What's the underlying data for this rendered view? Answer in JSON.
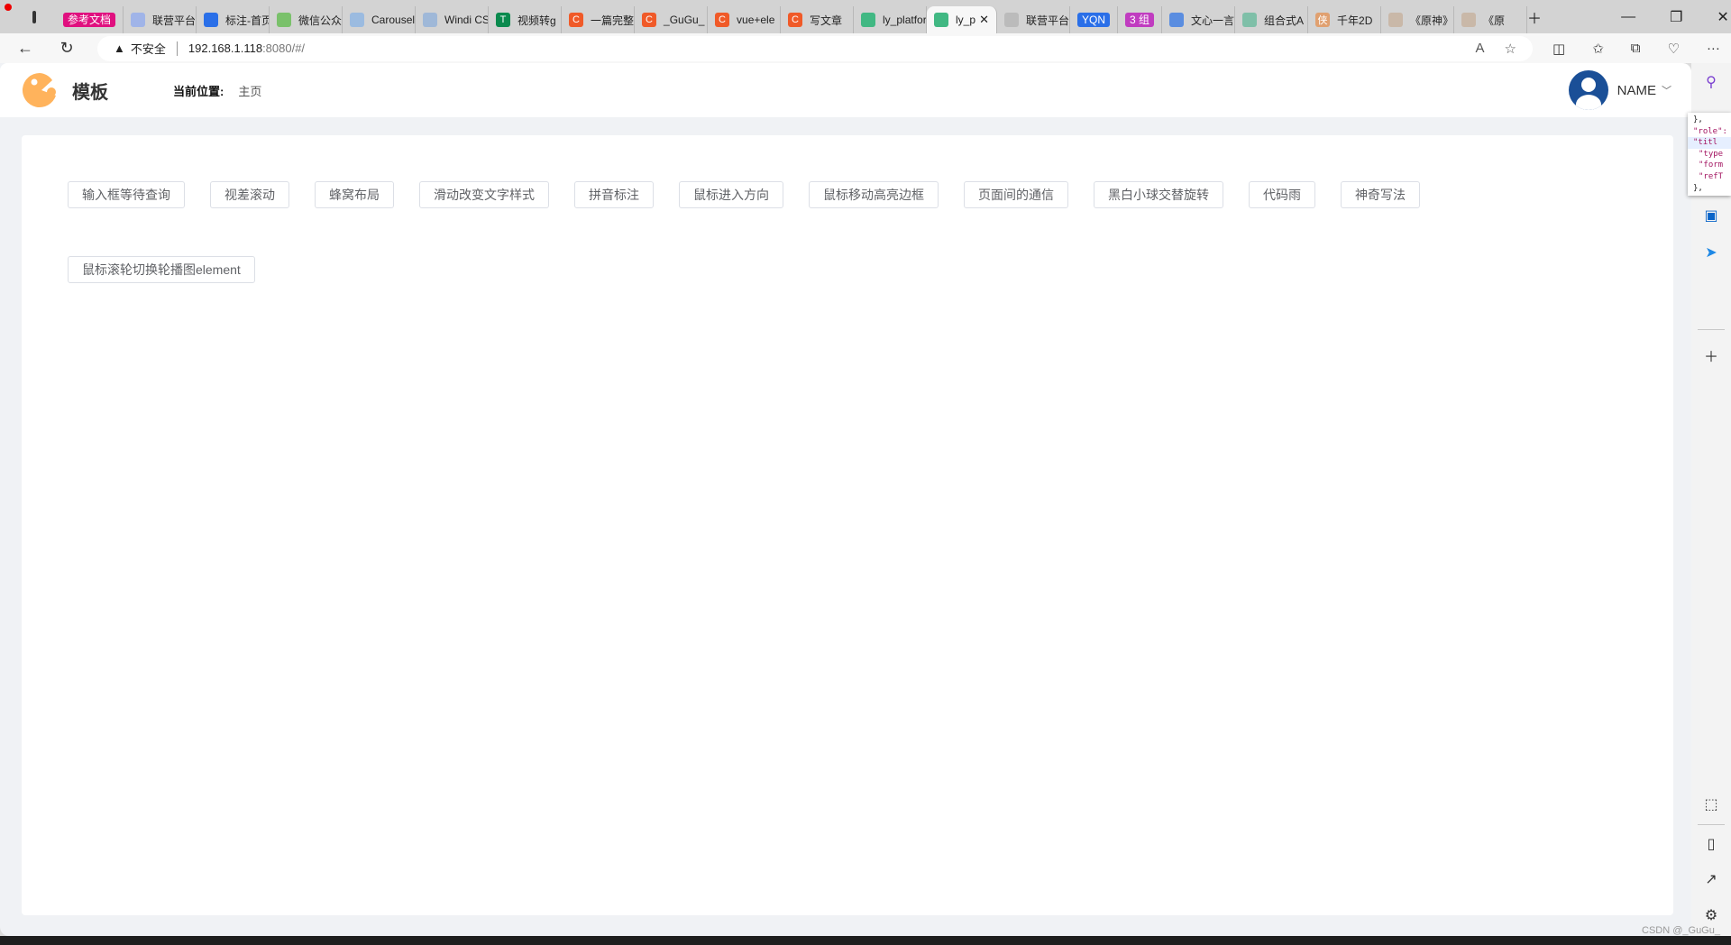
{
  "browser": {
    "tabs": [
      {
        "group": "参考文档",
        "group_color": "#e0107f"
      },
      {
        "label": "联营平台",
        "icon": "ghost-favicon",
        "color": "#a0b4e8"
      },
      {
        "label": "标注-首页",
        "icon": "ghost-favicon",
        "color": "#2a6fe8"
      },
      {
        "label": "微信公众",
        "icon": "wechat-favicon",
        "color": "#7ac16b"
      },
      {
        "label": "Carousel",
        "icon": "carousel-favicon",
        "color": "#9bbbe0"
      },
      {
        "label": "Windi CSS",
        "icon": "windi-favicon",
        "color": "#9fb8d8"
      },
      {
        "label": "视频转g",
        "icon": "T",
        "color": "#0a8a4e"
      },
      {
        "label": "一篇完整",
        "icon": "C",
        "color": "#f05a28"
      },
      {
        "label": "_GuGu_",
        "icon": "C",
        "color": "#f05a28"
      },
      {
        "label": "vue+ele",
        "icon": "C",
        "color": "#f05a28"
      },
      {
        "label": "写文章",
        "icon": "C",
        "color": "#f05a28"
      },
      {
        "label": "ly_platform",
        "icon": "vue-favicon",
        "color": "#41b883"
      },
      {
        "label": "ly_p",
        "icon": "vue-favicon",
        "color": "#41b883",
        "active": true
      },
      {
        "label": "联营平台",
        "icon": "page-favicon",
        "color": "#bbbbbb"
      },
      {
        "group": "YQN",
        "group_color": "#2a6fe8"
      },
      {
        "group": "3 组",
        "group_color": "#c03cc0"
      },
      {
        "label": "文心一言",
        "icon": "wenxin-favicon",
        "color": "#5a8de0"
      },
      {
        "label": "组合式A",
        "icon": "vue-favicon",
        "color": "#7fbfa8"
      },
      {
        "label": "千年2D",
        "icon": "侠",
        "color": "#e0a070"
      },
      {
        "label": "《原神》",
        "icon": "avatar-favicon",
        "color": "#c9b8a8"
      },
      {
        "label": "《原",
        "icon": "avatar-favicon",
        "color": "#c9b8a8",
        "audio": true
      }
    ],
    "address": {
      "security": "不安全",
      "host": "192.168.1.118",
      "rest": ":8080/#/"
    }
  },
  "app": {
    "title": "模板",
    "breadcrumb_label": "当前位置:",
    "breadcrumb_value": "主页",
    "user_name": "NAME",
    "accent": "#ffb35c"
  },
  "buttons": [
    "输入框等待查询",
    "视差滚动",
    "蜂窝布局",
    "滑动改变文字样式",
    "拼音标注",
    "鼠标进入方向",
    "鼠标移动高亮边框",
    "页面间的通信",
    "黑白小球交替旋转",
    "代码雨",
    "神奇写法",
    "鼠标滚轮切换轮播图element"
  ],
  "json_popup": [
    "},",
    "\"role\":",
    "\"titl",
    "\"type",
    "\"form",
    "\"refT",
    "},"
  ],
  "watermark": "CSDN @_GuGu_"
}
